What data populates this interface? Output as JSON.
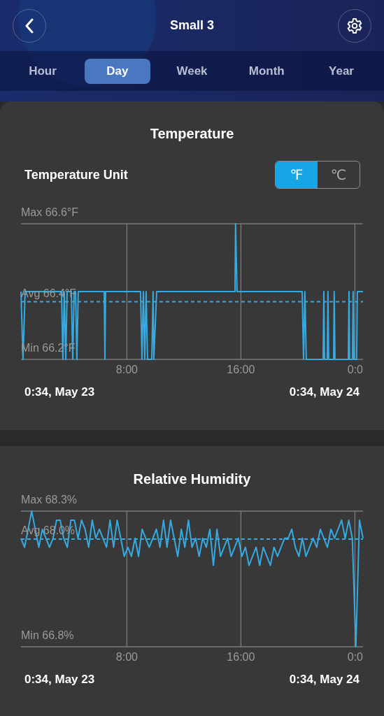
{
  "header": {
    "title": "Small 3"
  },
  "tabs": [
    {
      "label": "Hour",
      "selected": false
    },
    {
      "label": "Day",
      "selected": true
    },
    {
      "label": "Week",
      "selected": false
    },
    {
      "label": "Month",
      "selected": false
    },
    {
      "label": "Year",
      "selected": false
    }
  ],
  "temperature": {
    "title": "Temperature",
    "unit_label": "Temperature Unit",
    "units": [
      {
        "label": "℉",
        "selected": true
      },
      {
        "label": "℃",
        "selected": false
      }
    ],
    "chart": {
      "kind": "step",
      "max_label": "Max 66.6°F",
      "avg_label": "Avg 66.4°F",
      "min_label": "Min 66.2°F",
      "x_labels": [
        "8:00",
        "16:00",
        "0:0"
      ]
    },
    "range": {
      "start": "0:34,  May 23",
      "end": "0:34,  May 24"
    }
  },
  "humidity": {
    "title": "Relative Humidity",
    "chart": {
      "kind": "noisy",
      "max_label": "Max 68.3%",
      "avg_label": "Avg 68.0%",
      "min_label": "Min 66.8%",
      "x_labels": [
        "8:00",
        "16:00",
        "0:0"
      ]
    },
    "range": {
      "start": "0:34,  May 23",
      "end": "0:34,  May 24"
    }
  }
}
